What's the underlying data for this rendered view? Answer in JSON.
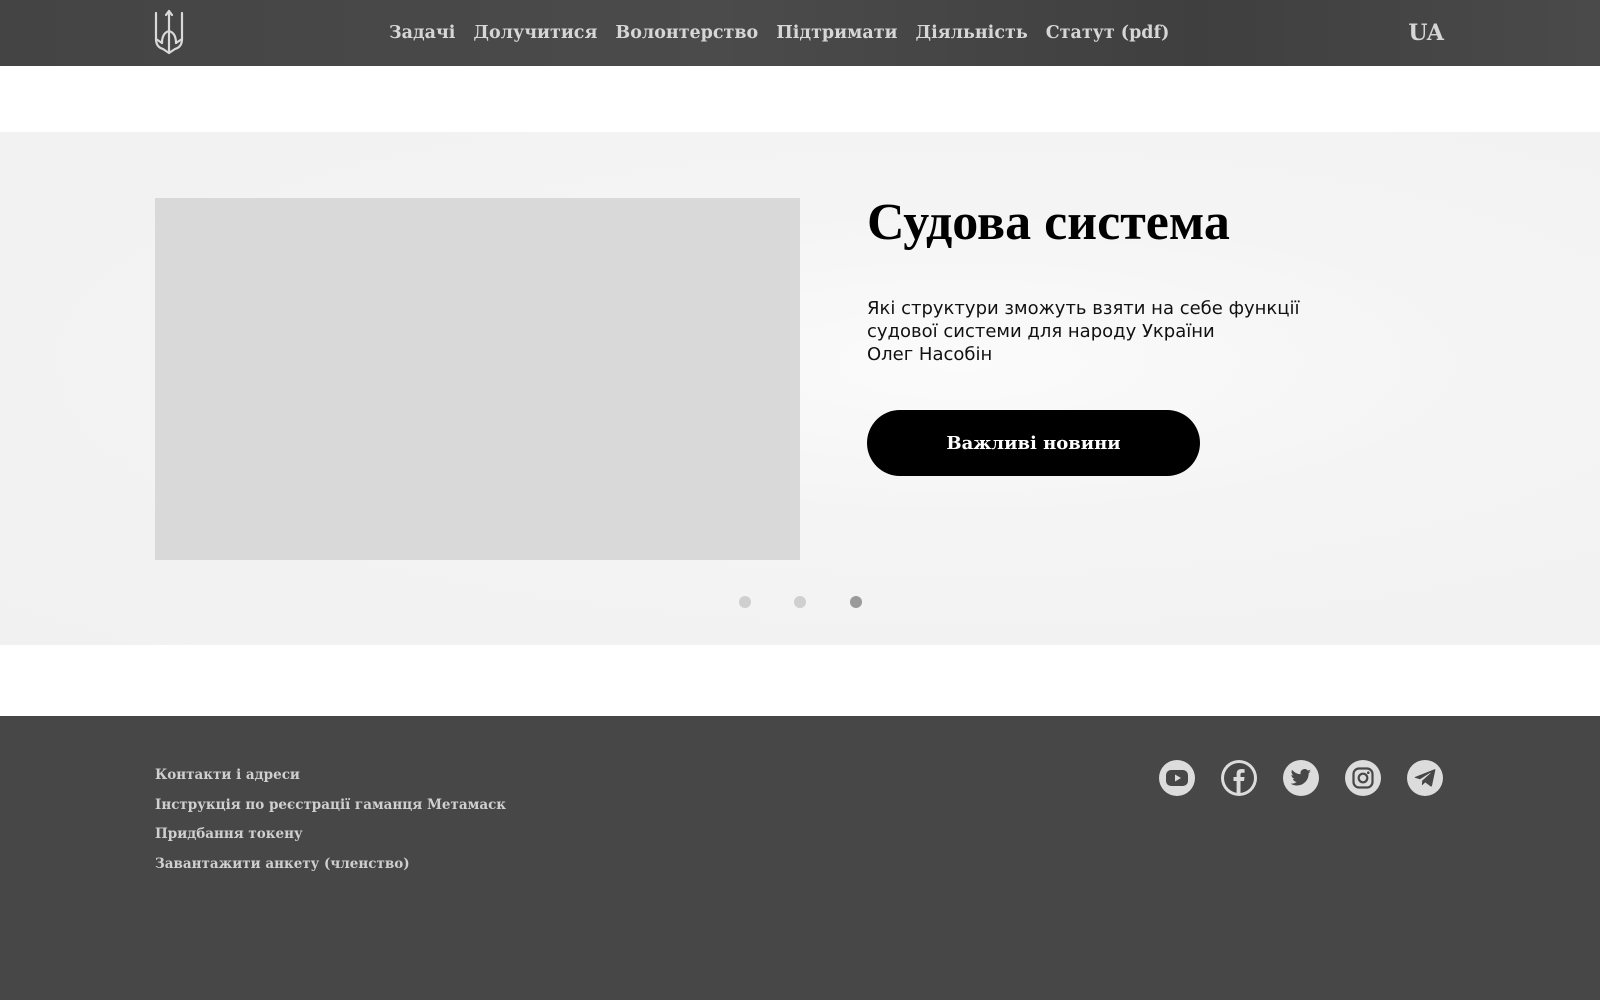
{
  "header": {
    "logo_icon": "trident-icon",
    "nav": [
      {
        "label": "Задачі"
      },
      {
        "label": "Долучитися"
      },
      {
        "label": "Волонтерство"
      },
      {
        "label": "Підтримати"
      },
      {
        "label": "Діяльність"
      },
      {
        "label": "Статут (pdf)"
      }
    ],
    "language": "UA"
  },
  "slider": {
    "slide": {
      "title": "Судова система",
      "description": "Які структури зможуть взяти на себе функції судової системи для народу України",
      "author": "Олег Насобін",
      "button_label": "Важливі новини"
    },
    "dots_count": 3,
    "active_dot": 3
  },
  "footer": {
    "links": [
      {
        "label": "Контакти і адреси"
      },
      {
        "label": "Інструкція по реєстрації гаманця Метамаск"
      },
      {
        "label": "Придбання токену"
      },
      {
        "label": "Завантажити анкету (членство)"
      }
    ],
    "socials": [
      {
        "icon": "youtube-icon"
      },
      {
        "icon": "facebook-icon"
      },
      {
        "icon": "twitter-icon"
      },
      {
        "icon": "instagram-icon"
      },
      {
        "icon": "telegram-icon"
      }
    ]
  },
  "colors": {
    "header_bg": "#474747",
    "footer_bg": "#474747",
    "hero_bg": "#f2f2f2",
    "image_placeholder": "#d9d9d9",
    "button_bg": "#000000",
    "nav_text": "#d6d6d6"
  }
}
